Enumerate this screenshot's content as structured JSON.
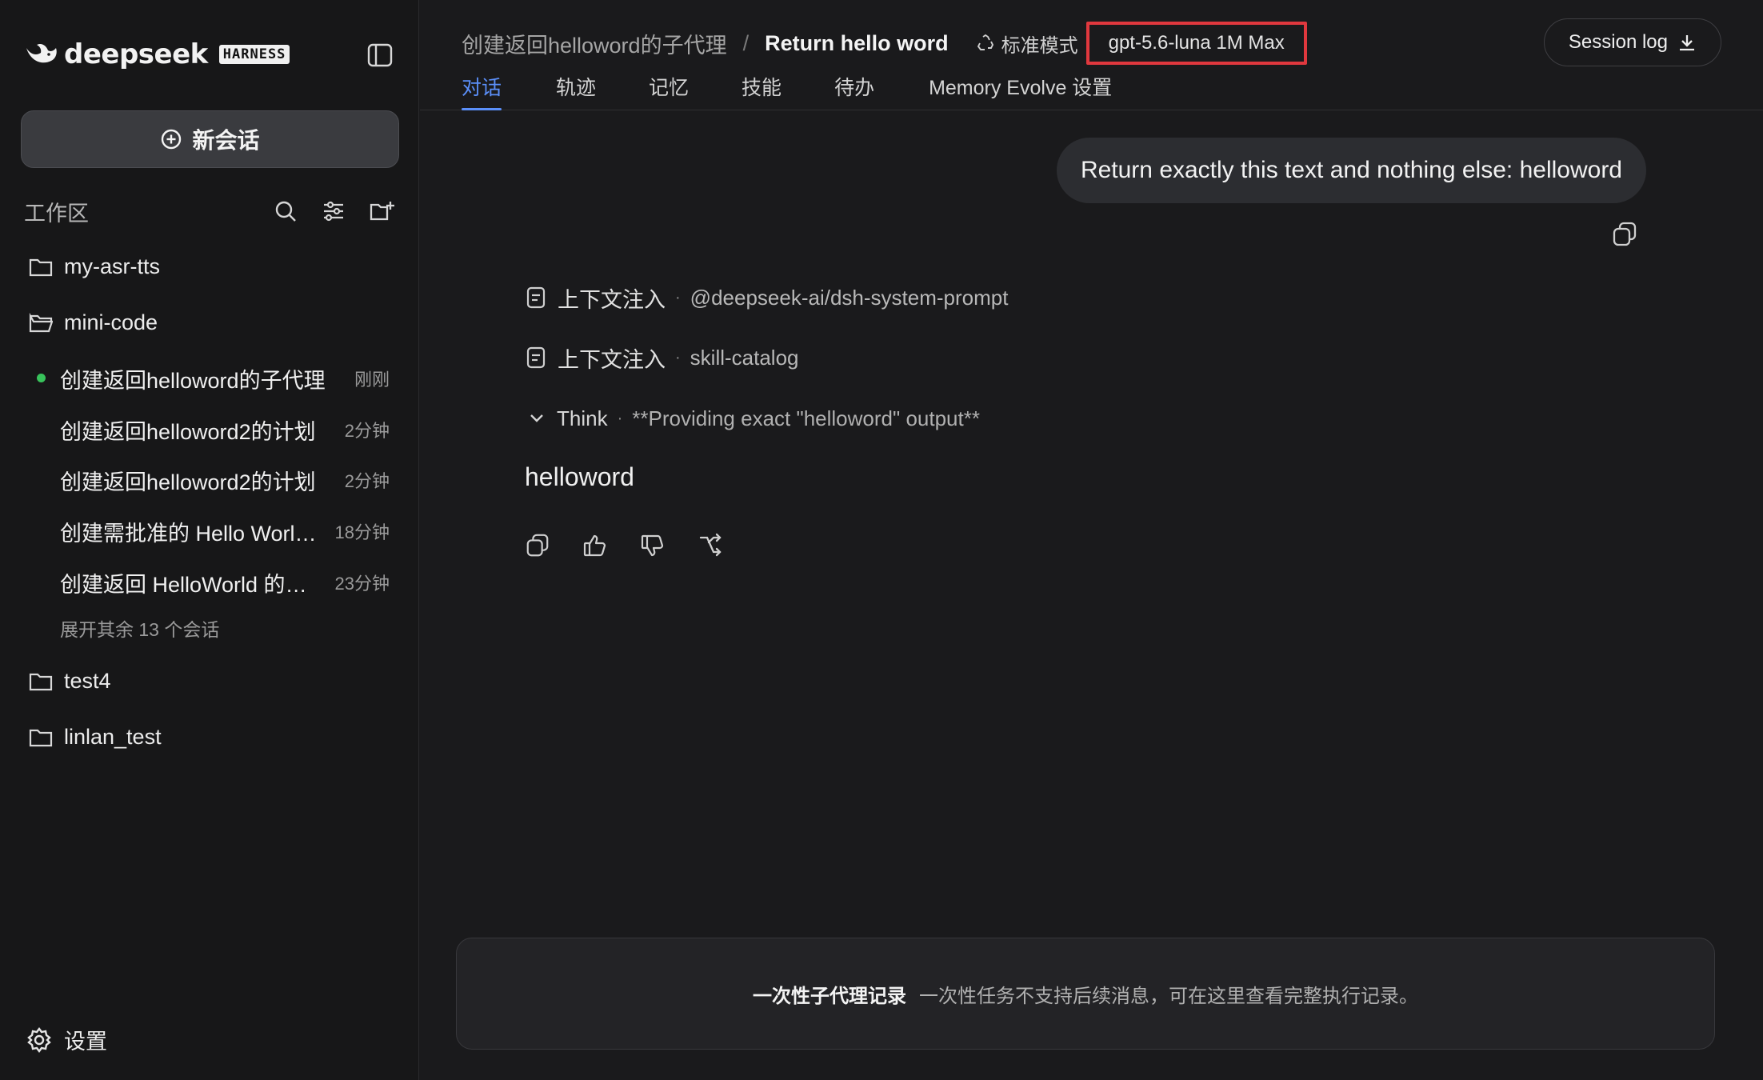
{
  "brand": {
    "name": "deepseek",
    "badge": "HARNESS"
  },
  "sidebar": {
    "new_chat_label": "新会话",
    "workspace_title": "工作区",
    "folders": [
      {
        "name": "my-asr-tts"
      },
      {
        "name": "mini-code"
      },
      {
        "name": "test4"
      },
      {
        "name": "linlan_test"
      }
    ],
    "sessions": [
      {
        "title": "创建返回helloword的子代理",
        "time": "刚刚",
        "active": true
      },
      {
        "title": "创建返回helloword2的计划",
        "time": "2分钟"
      },
      {
        "title": "创建返回helloword2的计划",
        "time": "2分钟"
      },
      {
        "title": "创建需批准的 Hello World ...",
        "time": "18分钟"
      },
      {
        "title": "创建返回 HelloWorld 的子...",
        "time": "23分钟"
      }
    ],
    "expand_more": "展开其余 13 个会话",
    "settings_label": "设置"
  },
  "header": {
    "breadcrumb_parent": "创建返回helloword的子代理",
    "breadcrumb_sep": "/",
    "breadcrumb_current": "Return hello word",
    "mode": "标准模式",
    "model": "gpt-5.6-luna 1M Max",
    "session_log": "Session log",
    "tabs": [
      {
        "label": "对话",
        "active": true
      },
      {
        "label": "轨迹"
      },
      {
        "label": "记忆"
      },
      {
        "label": "技能"
      },
      {
        "label": "待办"
      },
      {
        "label": "Memory Evolve 设置"
      }
    ]
  },
  "conversation": {
    "user_message": "Return exactly this text and nothing else: helloword",
    "context_items": [
      {
        "label": "上下文注入",
        "value": "@deepseek-ai/dsh-system-prompt"
      },
      {
        "label": "上下文注入",
        "value": "skill-catalog"
      }
    ],
    "think": {
      "label": "Think",
      "summary": "**Providing exact \"helloword\" output**"
    },
    "separator": "·",
    "answer": "helloword"
  },
  "footer": {
    "title": "一次性子代理记录",
    "text": "一次性任务不支持后续消息，可在这里查看完整执行记录。"
  },
  "colors": {
    "accent": "#5b8ff9",
    "active_dot": "#38c35b",
    "highlight_border": "#e0383e",
    "background": "#1a1a1c"
  },
  "icons": [
    "whale-logo-icon",
    "sidebar-toggle-icon",
    "plus-circle-icon",
    "search-icon",
    "filter-icon",
    "new-folder-icon",
    "folder-icon",
    "folder-open-icon",
    "settings-gear-icon",
    "recycle-icon",
    "download-icon",
    "copy-icon",
    "document-icon",
    "chevron-down-icon",
    "thumbs-up-icon",
    "thumbs-down-icon",
    "branch-icon"
  ]
}
